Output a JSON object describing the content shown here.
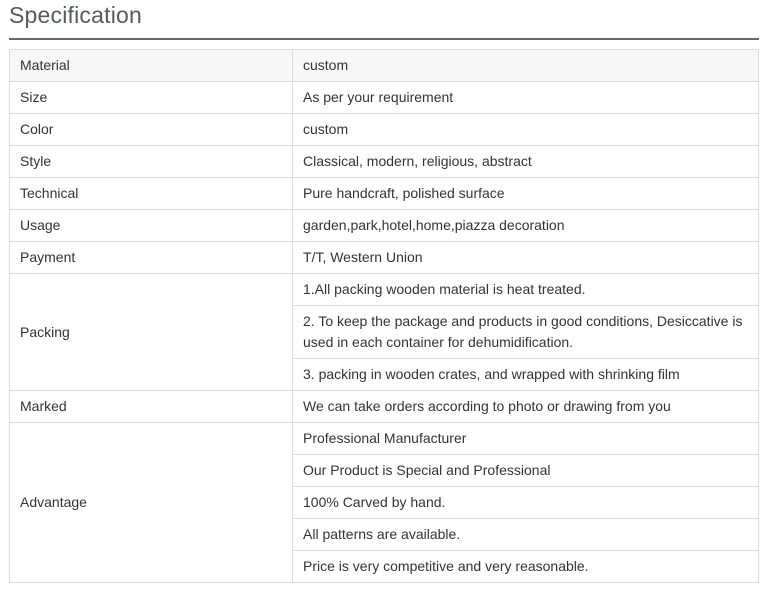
{
  "title": "Specification",
  "rows": {
    "material": {
      "label": "Material",
      "value": "custom"
    },
    "size": {
      "label": "Size",
      "value": "As per your requirement"
    },
    "color": {
      "label": "Color",
      "value": "custom"
    },
    "style": {
      "label": "Style",
      "value": "Classical, modern, religious, abstract"
    },
    "technical": {
      "label": "Technical",
      "value": "Pure handcraft, polished surface"
    },
    "usage": {
      "label": "Usage",
      "value": "garden,park,hotel,home,piazza decoration"
    },
    "payment": {
      "label": "Payment",
      "value": "T/T, Western Union"
    },
    "packing": {
      "label": "Packing",
      "values": [
        "1.All packing wooden material is heat treated.",
        "2. To keep the package and products in good conditions, Desiccative is used in each container for dehumidification.",
        "3. packing in wooden crates, and wrapped with shrinking film"
      ]
    },
    "marked": {
      "label": "Marked",
      "value": "We can take orders according to photo or drawing from you"
    },
    "advantage": {
      "label": "Advantage",
      "values": [
        "Professional Manufacturer",
        "Our Product is Special and Professional",
        "100% Carved by hand.",
        "All patterns are available.",
        "Price is very competitive and very reasonable."
      ]
    }
  }
}
